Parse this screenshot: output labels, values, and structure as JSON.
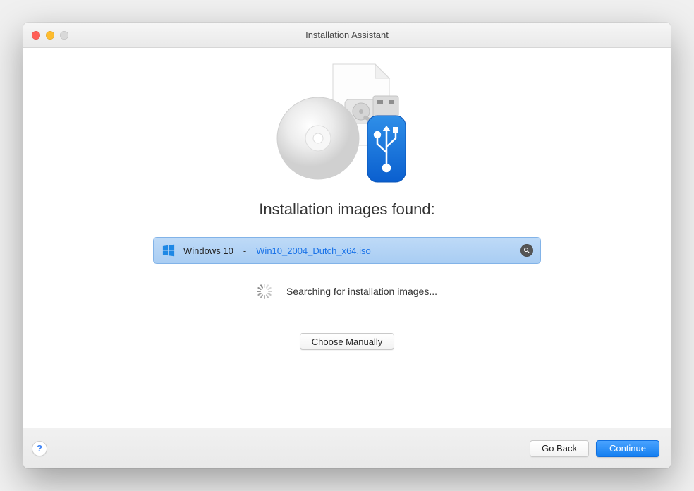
{
  "window": {
    "title": "Installation Assistant"
  },
  "main": {
    "heading": "Installation images found:",
    "image_row": {
      "os_name": "Windows 10",
      "separator": "-",
      "filename": "Win10_2004_Dutch_x64.iso",
      "reveal_icon": "magnify-icon"
    },
    "searching_label": "Searching for installation images...",
    "choose_manually_label": "Choose Manually"
  },
  "footer": {
    "help_label": "?",
    "go_back_label": "Go Back",
    "continue_label": "Continue"
  }
}
